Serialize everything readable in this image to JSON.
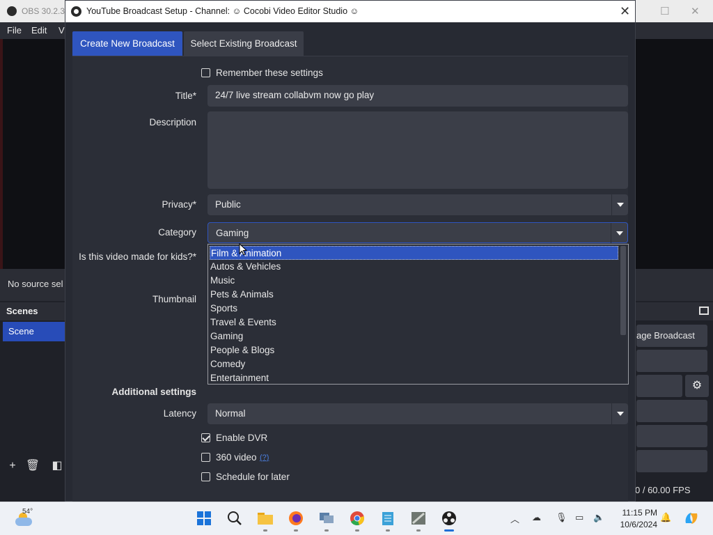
{
  "obs": {
    "title": "OBS 30.2.3",
    "menu": [
      "File",
      "Edit",
      "V"
    ],
    "status_text": "No source sel",
    "scenes_header": "Scenes",
    "scene_item": "Scene",
    "right_buttons": [
      "age Broadcast"
    ],
    "fps": "0 / 60.00 FPS"
  },
  "dialog": {
    "title": "YouTube Broadcast Setup - Channel: ☺ Cocobi Video Editor Studio ☺",
    "tabs": {
      "create": "Create New Broadcast",
      "select": "Select Existing Broadcast"
    },
    "remember_label": "Remember these settings",
    "remember_checked": false,
    "labels": {
      "title": "Title*",
      "description": "Description",
      "privacy": "Privacy*",
      "category": "Category",
      "kids": "Is this video made for kids?*",
      "thumbnail": "Thumbnail",
      "additional": "Additional settings",
      "latency": "Latency"
    },
    "title_value": "24/7 live stream collabvm now go play",
    "description_value": "",
    "privacy_value": "Public",
    "category_value": "Gaming",
    "category_options": [
      "Film & Animation",
      "Autos & Vehicles",
      "Music",
      "Pets & Animals",
      "Sports",
      "Travel & Events",
      "Gaming",
      "People & Blogs",
      "Comedy",
      "Entertainment"
    ],
    "category_highlighted": "Film & Animation",
    "latency_value": "Normal",
    "checkboxes": {
      "dvr": {
        "label": "Enable DVR",
        "checked": true
      },
      "video360": {
        "label": "360 video",
        "checked": false,
        "help": "(?)"
      },
      "schedule": {
        "label": "Schedule for later",
        "checked": false
      }
    }
  },
  "taskbar": {
    "temperature": "54°",
    "time": "11:15 PM",
    "date": "10/6/2024"
  },
  "colors": {
    "accent": "#2f55bf",
    "dialog_bg": "#272a33",
    "field_bg": "#3b3e48"
  }
}
